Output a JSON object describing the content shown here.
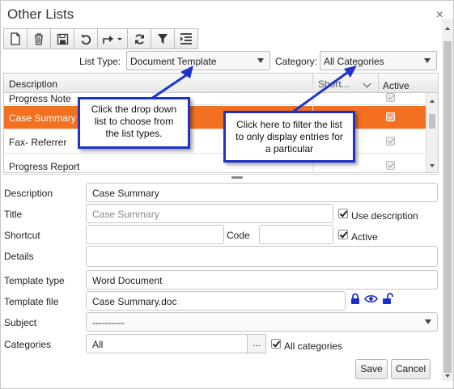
{
  "window": {
    "title": "Other Lists",
    "close_glyph": "×"
  },
  "toolbar": {
    "buttons": [
      "new-document-icon",
      "delete-trash-icon",
      "save-disk-icon",
      "undo-icon",
      "share-export-icon",
      "refresh-icon",
      "filter-icon",
      "indent-list-icon"
    ]
  },
  "filters": {
    "list_type_label": "List Type:",
    "list_type_value": "Document Template",
    "category_label": "Category:",
    "category_value": "All Categories"
  },
  "grid": {
    "columns": [
      "Description",
      "Short...",
      "Active"
    ],
    "rows": [
      {
        "description": "Progress Note",
        "active": true,
        "selected": false
      },
      {
        "description": "Case Summary",
        "active": true,
        "selected": true
      },
      {
        "description": "Fax- Referrer",
        "active": true,
        "selected": false
      },
      {
        "description": "Progress Report",
        "active": true,
        "selected": false
      }
    ]
  },
  "form": {
    "description_label": "Description",
    "description_value": "Case Summary",
    "title_label": "Title",
    "title_value": "Case Summary",
    "use_description_label": "Use description",
    "shortcut_label": "Shortcut",
    "shortcut_value": "",
    "code_label": "Code",
    "code_value": "",
    "active_label": "Active",
    "details_label": "Details",
    "details_value": "",
    "template_type_label": "Template type",
    "template_type_value": "Word Document",
    "template_file_label": "Template file",
    "template_file_value": "Case Summary.doc",
    "subject_label": "Subject",
    "subject_value": "----------",
    "categories_label": "Categories",
    "categories_value": "All",
    "categories_btn": "...",
    "all_categories_label": "All categories",
    "save_label": "Save",
    "cancel_label": "Cancel"
  },
  "callouts": {
    "list_type_help": "Click the drop down list to choose from the list types.",
    "category_help": "Click here to filter the list to only display entries for a particular"
  },
  "colors": {
    "selected_row": "#f37021",
    "callout_border": "#1f33c8",
    "lock_icon": "#1a2fd0"
  }
}
